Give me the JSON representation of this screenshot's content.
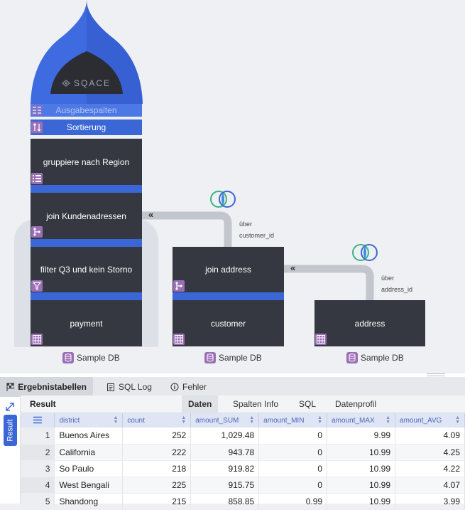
{
  "flow": {
    "brand": "SQACE",
    "output_columns_label": "Ausgabespalten",
    "sort_label": "Sortierung",
    "main_nodes": [
      {
        "label": "gruppiere nach Region",
        "icon": "list-icon"
      },
      {
        "label": "join Kundenadressen",
        "icon": "join-icon"
      },
      {
        "label": "filter Q3 und kein Storno",
        "icon": "filter-icon"
      },
      {
        "label": "payment",
        "icon": "table-icon"
      }
    ],
    "join_address_label": "join address",
    "customer_label": "customer",
    "address_label": "address",
    "via_customer": {
      "word": "über",
      "key": "customer_id"
    },
    "via_address": {
      "word": "über",
      "key": "address_id"
    },
    "join_glyph": "«",
    "db_labels": [
      "Sample DB",
      "Sample DB",
      "Sample DB"
    ],
    "colors": {
      "blue": "#3b67d6",
      "node": "#353840",
      "icon": "#9b6fb5",
      "connector": "#c3c7cd"
    }
  },
  "panel": {
    "tabs": [
      {
        "label": "Ergebnistabellen",
        "icon": "checkered-flag-icon"
      },
      {
        "label": "SQL Log",
        "icon": "log-icon"
      },
      {
        "label": "Fehler",
        "icon": "info-circle-icon"
      }
    ],
    "side_tab": "Result",
    "result_title": "Result",
    "sub_tabs": [
      "Daten",
      "Spalten Info",
      "SQL",
      "Datenprofil"
    ],
    "table": {
      "columns": [
        "district",
        "count",
        "amount_SUM",
        "amount_MIN",
        "amount_MAX",
        "amount_AVG"
      ],
      "rows": [
        [
          "1",
          "Buenos Aires",
          "252",
          "1,029.48",
          "0",
          "9.99",
          "4.09"
        ],
        [
          "2",
          "California",
          "222",
          "943.78",
          "0",
          "10.99",
          "4.25"
        ],
        [
          "3",
          "So Paulo",
          "218",
          "919.82",
          "0",
          "10.99",
          "4.22"
        ],
        [
          "4",
          "West Bengali",
          "225",
          "915.75",
          "0",
          "10.99",
          "4.07"
        ],
        [
          "5",
          "Shandong",
          "215",
          "858.85",
          "0.99",
          "10.99",
          "3.99"
        ]
      ]
    }
  }
}
